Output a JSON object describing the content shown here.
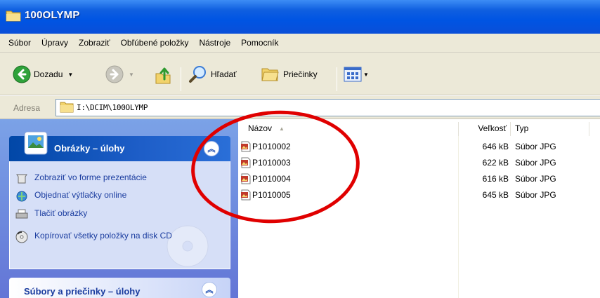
{
  "window": {
    "title": "100OLYMP"
  },
  "menu": [
    "Súbor",
    "Úpravy",
    "Zobraziť",
    "Obľúbené položky",
    "Nástroje",
    "Pomocník"
  ],
  "toolbar": {
    "back_label": "Dozadu",
    "search_label": "Hľadať",
    "folders_label": "Priečinky"
  },
  "address": {
    "label": "Adresa",
    "path": "I:\\DCIM\\100OLYMP"
  },
  "tasks_panel": {
    "title": "Obrázky – úlohy",
    "items": [
      {
        "label": "Zobraziť vo forme prezentácie",
        "icon": "slideshow-icon"
      },
      {
        "label": "Objednať výtlačky online",
        "icon": "order-prints-icon"
      },
      {
        "label": "Tlačiť obrázky",
        "icon": "printer-icon"
      },
      {
        "label": "Kopírovať všetky položky na disk CD",
        "icon": "cd-copy-icon"
      }
    ]
  },
  "files_panel": {
    "title": "Súbory a priečinky – úlohy"
  },
  "columns": {
    "name": "Názov",
    "size": "Veľkosť",
    "type": "Typ"
  },
  "files": [
    {
      "name": "P1010002",
      "size": "646 kB",
      "type": "Súbor JPG"
    },
    {
      "name": "P1010003",
      "size": "622 kB",
      "type": "Súbor JPG"
    },
    {
      "name": "P1010004",
      "size": "616 kB",
      "type": "Súbor JPG"
    },
    {
      "name": "P1010005",
      "size": "645 kB",
      "type": "Súbor JPG"
    }
  ],
  "colors": {
    "title_bar": "#0054e3",
    "task_pane": "#7ba2e7",
    "highlight_circle": "#e00000"
  }
}
